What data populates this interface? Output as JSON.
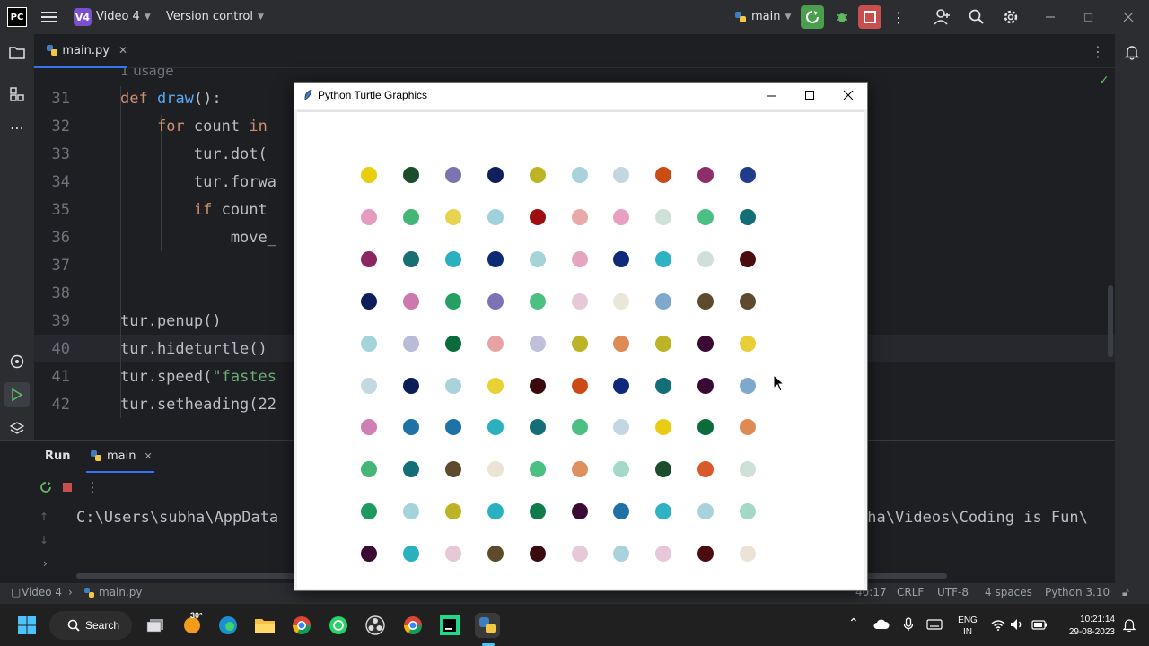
{
  "titlebar": {
    "app_logo": "PC",
    "project_badge": "V4",
    "project_name": "Video 4",
    "vcs_label": "Version control",
    "branch": "main"
  },
  "editor": {
    "tab_file": "main.py",
    "usage_hint": "1 usage",
    "lines": [
      {
        "n": "31",
        "code": "def draw():"
      },
      {
        "n": "32",
        "code": "    for count in "
      },
      {
        "n": "33",
        "code": "        tur.dot("
      },
      {
        "n": "34",
        "code": "        tur.forwa"
      },
      {
        "n": "35",
        "code": "        if count "
      },
      {
        "n": "36",
        "code": "            move_"
      },
      {
        "n": "37",
        "code": ""
      },
      {
        "n": "38",
        "code": ""
      },
      {
        "n": "39",
        "code": "tur.penup()"
      },
      {
        "n": "40",
        "code": "tur.hideturtle()"
      },
      {
        "n": "41",
        "code": "tur.speed(\"fastes"
      },
      {
        "n": "42",
        "code": "tur.setheading(22"
      }
    ]
  },
  "run_panel": {
    "run_label": "Run",
    "tab_main": "main",
    "console_left": "C:\\Users\\subha\\AppData",
    "console_right": "pha\\Videos\\Coding is Fun\\"
  },
  "statusbar": {
    "project": "Video 4",
    "file": "main.py",
    "position": "40:17",
    "line_sep": "CRLF",
    "encoding": "UTF-8",
    "indent": "4 spaces",
    "interpreter": "Python 3.10"
  },
  "turtle_window": {
    "title": "Python Turtle Graphics",
    "dot_rows": [
      [
        "#e8cf0c",
        "#1b4d2c",
        "#7a74b0",
        "#0f1f5a",
        "#bcb424",
        "#a8d3da",
        "#c2d7df",
        "#cb4b17",
        "#8e2f6c",
        "#1f3d8a"
      ],
      [
        "#e59bbd",
        "#44b776",
        "#e8d34e",
        "#9fd1da",
        "#9e0d10",
        "#e8a9a8",
        "#e89fc2",
        "#cfe0d8",
        "#4cbf83",
        "#136e77"
      ],
      [
        "#8a2663",
        "#176f73",
        "#2bb0c0",
        "#0f2a75",
        "#a4d3d8",
        "#e5a4c0",
        "#0f2a7a",
        "#2fb2c4",
        "#cfe0d8",
        "#4a0c0f"
      ],
      [
        "#0c1e5a",
        "#cc7aad",
        "#25a065",
        "#7c72b4",
        "#4cbf83",
        "#e6c8d8",
        "#eae6d8",
        "#7fa9cc",
        "#5e4a2c",
        "#5e4a2c"
      ],
      [
        "#a4d3da",
        "#b8bcd8",
        "#0b6b3b",
        "#e7a3a3",
        "#c0c0dc",
        "#bcb424",
        "#dd8a55",
        "#bcb424",
        "#3b0a34",
        "#e8cf38"
      ],
      [
        "#c4d8e2",
        "#0c1e5a",
        "#a8d3dc",
        "#e8d134",
        "#3b0a10",
        "#cc4a18",
        "#0f2a7a",
        "#136e77",
        "#3b0a34",
        "#7fa9cc"
      ],
      [
        "#cf7fb4",
        "#1e72a5",
        "#1e72a5",
        "#2bb0c0",
        "#136e77",
        "#4cbf83",
        "#c2d7df",
        "#eacd12",
        "#0b6b3b",
        "#dd8a55"
      ],
      [
        "#44b776",
        "#136e77",
        "#5e4a2c",
        "#ebe3d5",
        "#4cbf83",
        "#dd9060",
        "#a4d8c8",
        "#1b4d2c",
        "#d85a2a",
        "#cfe0d8"
      ],
      [
        "#1e9a5e",
        "#a4d3da",
        "#bcb424",
        "#2bb0c0",
        "#0f7a4a",
        "#3b0a34",
        "#1e72a5",
        "#2fb2c4",
        "#a8d3dc",
        "#a4d8c8"
      ],
      [
        "#3b0a34",
        "#2bb0c0",
        "#e6c8d8",
        "#5e4a2c",
        "#3b0a10",
        "#e6c8d8",
        "#a8d3dc",
        "#e6c8d8",
        "#4a0c0f",
        "#ebe3d5"
      ]
    ]
  },
  "taskbar": {
    "search_label": "Search",
    "weather": "30°",
    "lang_top": "ENG",
    "lang_bottom": "IN",
    "time": "10:21:14",
    "date": "29-08-2023"
  },
  "colors": {
    "ide_bg": "#1e1f22",
    "panel_bg": "#2b2d30",
    "run_green": "#4b9e4e",
    "stop_red": "#c94f4f",
    "accent_blue": "#3574f0"
  }
}
